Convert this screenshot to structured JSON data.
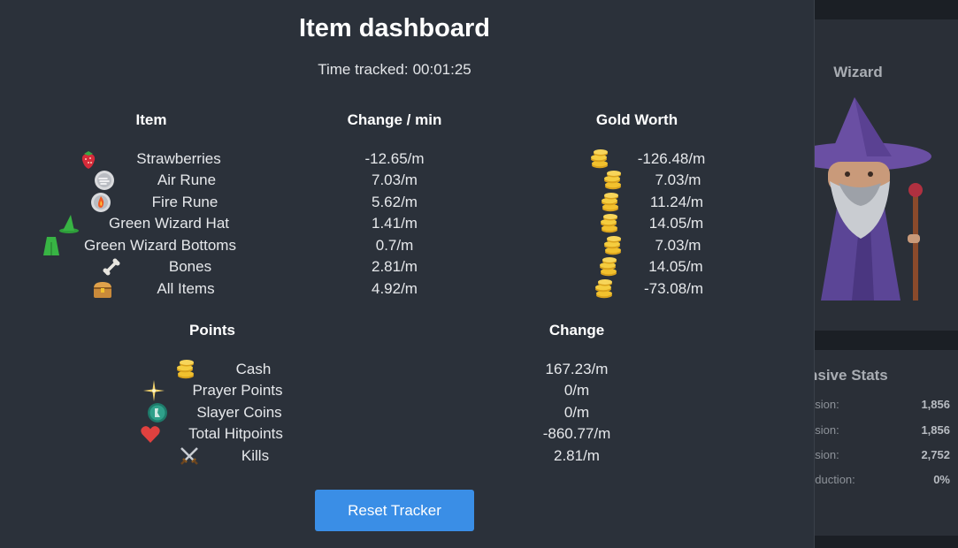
{
  "modal": {
    "title": "Item dashboard",
    "time_label": "Time tracked:",
    "time_value": "00:01:25"
  },
  "items_table": {
    "headers": {
      "item": "Item",
      "change": "Change / min",
      "gold": "Gold Worth"
    },
    "rows": [
      {
        "icon": "strawberry-icon",
        "name": "Strawberries",
        "change": "-12.65/m",
        "gold": "-126.48/m"
      },
      {
        "icon": "air-rune-icon",
        "name": "Air Rune",
        "change": "7.03/m",
        "gold": "7.03/m"
      },
      {
        "icon": "fire-rune-icon",
        "name": "Fire Rune",
        "change": "5.62/m",
        "gold": "11.24/m"
      },
      {
        "icon": "wizard-hat-icon",
        "name": "Green Wizard Hat",
        "change": "1.41/m",
        "gold": "14.05/m"
      },
      {
        "icon": "wizard-bottoms-icon",
        "name": "Green Wizard Bottoms",
        "change": "0.7/m",
        "gold": "7.03/m"
      },
      {
        "icon": "bones-icon",
        "name": "Bones",
        "change": "2.81/m",
        "gold": "14.05/m"
      },
      {
        "icon": "chest-icon",
        "name": "All Items",
        "change": "4.92/m",
        "gold": "-73.08/m"
      }
    ]
  },
  "points_table": {
    "headers": {
      "points": "Points",
      "change": "Change"
    },
    "rows": [
      {
        "icon": "coins-icon",
        "name": "Cash",
        "change": "167.23/m"
      },
      {
        "icon": "prayer-star-icon",
        "name": "Prayer Points",
        "change": "0/m"
      },
      {
        "icon": "slayer-coin-icon",
        "name": "Slayer Coins",
        "change": "0/m"
      },
      {
        "icon": "heart-icon",
        "name": "Total Hitpoints",
        "change": "-860.77/m"
      },
      {
        "icon": "crossed-swords-icon",
        "name": "Kills",
        "change": "2.81/m"
      }
    ]
  },
  "reset_button": {
    "label": "Reset Tracker"
  },
  "background": {
    "wizard_title": "Wizard",
    "stats_title": "nsive Stats",
    "stats": [
      {
        "label": "asion:",
        "value": "1,856"
      },
      {
        "label": "asion:",
        "value": "1,856"
      },
      {
        "label": "asion:",
        "value": "2,752"
      },
      {
        "label": "eduction:",
        "value": "0%"
      }
    ]
  },
  "colors": {
    "modal_bg": "#2b313a",
    "page_bg": "#1b1f25",
    "button": "#3a8ee6",
    "gold": "#f2c12e",
    "wizard_purple": "#6a4fa3"
  }
}
